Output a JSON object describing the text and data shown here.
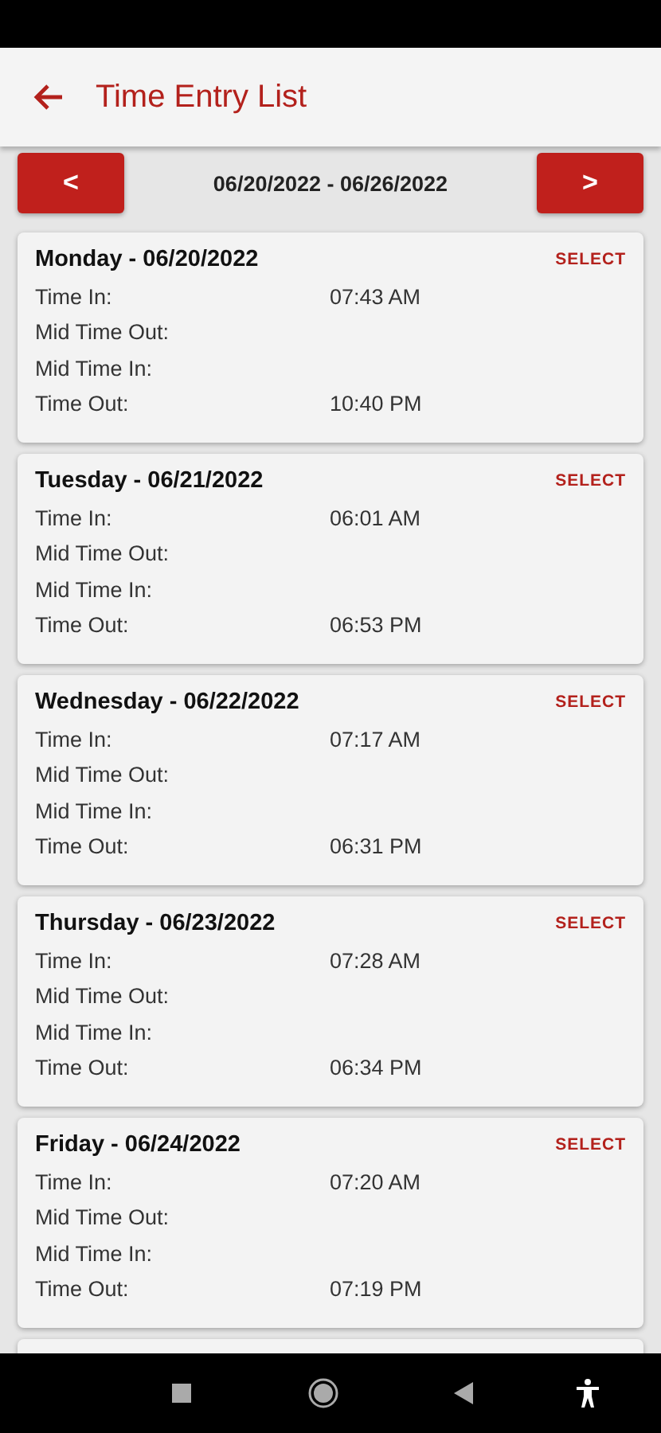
{
  "app_bar": {
    "title": "Time Entry List"
  },
  "week_nav": {
    "previous": "<",
    "range": "06/20/2022 - 06/26/2022",
    "next": ">"
  },
  "days": [
    {
      "title": "Monday - 06/20/2022",
      "action": "SELECT",
      "rows": [
        {
          "label": "Time In:",
          "value": "07:43 AM"
        },
        {
          "label": "Mid Time Out:"
        },
        {
          "label": "Mid Time In:"
        },
        {
          "label": "Time Out:",
          "value": "10:40 PM"
        }
      ]
    },
    {
      "title": "Tuesday - 06/21/2022",
      "action": "SELECT",
      "rows": [
        {
          "label": "Time In:",
          "value": "06:01 AM"
        },
        {
          "label": "Mid Time Out:"
        },
        {
          "label": "Mid Time In:"
        },
        {
          "label": "Time Out:",
          "value": "06:53 PM"
        }
      ]
    },
    {
      "title": "Wednesday - 06/22/2022",
      "action": "SELECT",
      "rows": [
        {
          "label": "Time In:",
          "value": "07:17 AM"
        },
        {
          "label": "Mid Time Out:"
        },
        {
          "label": "Mid Time In:"
        },
        {
          "label": "Time Out:",
          "value": "06:31 PM"
        }
      ]
    },
    {
      "title": "Thursday - 06/23/2022",
      "action": "SELECT",
      "rows": [
        {
          "label": "Time In:",
          "value": "07:28 AM"
        },
        {
          "label": "Mid Time Out:"
        },
        {
          "label": "Mid Time In:"
        },
        {
          "label": "Time Out:",
          "value": "06:34 PM"
        }
      ]
    },
    {
      "title": "Friday - 06/24/2022",
      "action": "SELECT",
      "rows": [
        {
          "label": "Time In:",
          "value": "07:20 AM"
        },
        {
          "label": "Mid Time Out:"
        },
        {
          "label": "Mid Time In:"
        },
        {
          "label": "Time Out:",
          "value": "07:19 PM"
        }
      ]
    }
  ]
}
